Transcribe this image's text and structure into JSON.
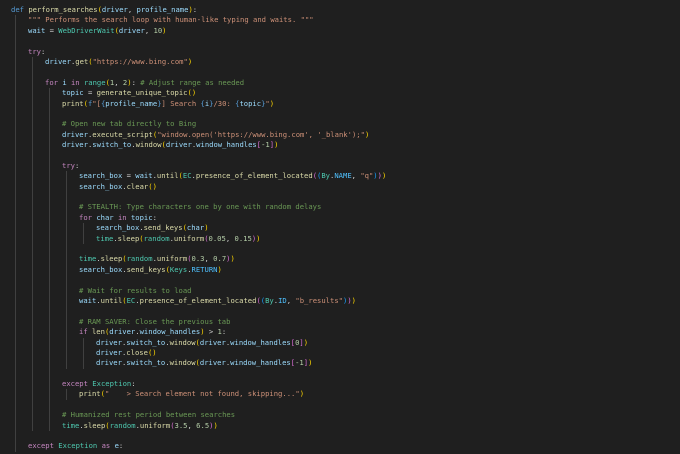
{
  "editor": {
    "lines": [
      {
        "indent": 0,
        "tokens": [
          [
            "k",
            "def"
          ],
          [
            "o",
            " "
          ],
          [
            "f",
            "perform_searches"
          ],
          [
            "b1",
            "("
          ],
          [
            "v",
            "driver"
          ],
          [
            "o",
            ", "
          ],
          [
            "v",
            "profile_name"
          ],
          [
            "b1",
            ")"
          ],
          [
            "o",
            ":"
          ]
        ]
      },
      {
        "indent": 1,
        "tokens": [
          [
            "s",
            "\"\"\" Performs the search loop with human-like typing and waits. \"\"\""
          ]
        ]
      },
      {
        "indent": 1,
        "tokens": [
          [
            "v",
            "wait"
          ],
          [
            "o",
            " = "
          ],
          [
            "cl",
            "WebDriverWait"
          ],
          [
            "b1",
            "("
          ],
          [
            "v",
            "driver"
          ],
          [
            "o",
            ", "
          ],
          [
            "n",
            "10"
          ],
          [
            "b1",
            ")"
          ]
        ]
      },
      {
        "indent": 0,
        "tokens": []
      },
      {
        "indent": 1,
        "tokens": [
          [
            "c",
            "try"
          ],
          [
            "o",
            ":"
          ]
        ]
      },
      {
        "indent": 2,
        "tokens": [
          [
            "v",
            "driver"
          ],
          [
            "o",
            "."
          ],
          [
            "f",
            "get"
          ],
          [
            "b1",
            "("
          ],
          [
            "s",
            "\"https://www.bing.com\""
          ],
          [
            "b1",
            ")"
          ]
        ]
      },
      {
        "indent": 0,
        "tokens": []
      },
      {
        "indent": 2,
        "tokens": [
          [
            "c",
            "for"
          ],
          [
            "o",
            " "
          ],
          [
            "v",
            "i"
          ],
          [
            "o",
            " "
          ],
          [
            "c",
            "in"
          ],
          [
            "o",
            " "
          ],
          [
            "cl",
            "range"
          ],
          [
            "b1",
            "("
          ],
          [
            "n",
            "1"
          ],
          [
            "o",
            ", "
          ],
          [
            "n",
            "2"
          ],
          [
            "b1",
            ")"
          ],
          [
            "o",
            ": "
          ],
          [
            "cm",
            "# Adjust range as needed"
          ]
        ]
      },
      {
        "indent": 3,
        "tokens": [
          [
            "v",
            "topic"
          ],
          [
            "o",
            " = "
          ],
          [
            "f",
            "generate_unique_topic"
          ],
          [
            "b1",
            "()"
          ]
        ]
      },
      {
        "indent": 3,
        "tokens": [
          [
            "f",
            "print"
          ],
          [
            "b1",
            "("
          ],
          [
            "k",
            "f"
          ],
          [
            "s",
            "\"["
          ],
          [
            "k",
            "{"
          ],
          [
            "v",
            "profile_name"
          ],
          [
            "k",
            "}"
          ],
          [
            "s",
            "] Search "
          ],
          [
            "k",
            "{"
          ],
          [
            "v",
            "i"
          ],
          [
            "k",
            "}"
          ],
          [
            "s",
            "/30: "
          ],
          [
            "k",
            "{"
          ],
          [
            "v",
            "topic"
          ],
          [
            "k",
            "}"
          ],
          [
            "s",
            "\""
          ],
          [
            "b1",
            ")"
          ]
        ]
      },
      {
        "indent": 0,
        "tokens": []
      },
      {
        "indent": 3,
        "tokens": [
          [
            "cm",
            "# Open new tab directly to Bing"
          ]
        ]
      },
      {
        "indent": 3,
        "tokens": [
          [
            "v",
            "driver"
          ],
          [
            "o",
            "."
          ],
          [
            "f",
            "execute_script"
          ],
          [
            "b1",
            "("
          ],
          [
            "s",
            "\"window.open('https://www.bing.com', '_blank');\""
          ],
          [
            "b1",
            ")"
          ]
        ]
      },
      {
        "indent": 3,
        "tokens": [
          [
            "v",
            "driver"
          ],
          [
            "o",
            "."
          ],
          [
            "v",
            "switch_to"
          ],
          [
            "o",
            "."
          ],
          [
            "f",
            "window"
          ],
          [
            "b1",
            "("
          ],
          [
            "v",
            "driver"
          ],
          [
            "o",
            "."
          ],
          [
            "v",
            "window_handles"
          ],
          [
            "b2",
            "["
          ],
          [
            "n",
            "-1"
          ],
          [
            "b2",
            "]"
          ],
          [
            "b1",
            ")"
          ]
        ]
      },
      {
        "indent": 0,
        "tokens": []
      },
      {
        "indent": 3,
        "tokens": [
          [
            "c",
            "try"
          ],
          [
            "o",
            ":"
          ]
        ]
      },
      {
        "indent": 4,
        "tokens": [
          [
            "v",
            "search_box"
          ],
          [
            "o",
            " = "
          ],
          [
            "v",
            "wait"
          ],
          [
            "o",
            "."
          ],
          [
            "f",
            "until"
          ],
          [
            "b1",
            "("
          ],
          [
            "cl",
            "EC"
          ],
          [
            "o",
            "."
          ],
          [
            "f",
            "presence_of_element_located"
          ],
          [
            "b2",
            "("
          ],
          [
            "b3",
            "("
          ],
          [
            "cl",
            "By"
          ],
          [
            "o",
            "."
          ],
          [
            "cst",
            "NAME"
          ],
          [
            "o",
            ", "
          ],
          [
            "s",
            "\"q\""
          ],
          [
            "b3",
            ")"
          ],
          [
            "b2",
            ")"
          ],
          [
            "b1",
            ")"
          ]
        ]
      },
      {
        "indent": 4,
        "tokens": [
          [
            "v",
            "search_box"
          ],
          [
            "o",
            "."
          ],
          [
            "f",
            "clear"
          ],
          [
            "b1",
            "()"
          ]
        ]
      },
      {
        "indent": 0,
        "tokens": []
      },
      {
        "indent": 4,
        "tokens": [
          [
            "cm",
            "# STEALTH: Type characters one by one with random delays"
          ]
        ]
      },
      {
        "indent": 4,
        "tokens": [
          [
            "c",
            "for"
          ],
          [
            "o",
            " "
          ],
          [
            "v",
            "char"
          ],
          [
            "o",
            " "
          ],
          [
            "c",
            "in"
          ],
          [
            "o",
            " "
          ],
          [
            "v",
            "topic"
          ],
          [
            "o",
            ":"
          ]
        ]
      },
      {
        "indent": 5,
        "tokens": [
          [
            "v",
            "search_box"
          ],
          [
            "o",
            "."
          ],
          [
            "f",
            "send_keys"
          ],
          [
            "b1",
            "("
          ],
          [
            "v",
            "char"
          ],
          [
            "b1",
            ")"
          ]
        ]
      },
      {
        "indent": 5,
        "tokens": [
          [
            "cl",
            "time"
          ],
          [
            "o",
            "."
          ],
          [
            "f",
            "sleep"
          ],
          [
            "b1",
            "("
          ],
          [
            "cl",
            "random"
          ],
          [
            "o",
            "."
          ],
          [
            "f",
            "uniform"
          ],
          [
            "b2",
            "("
          ],
          [
            "n",
            "0.05"
          ],
          [
            "o",
            ", "
          ],
          [
            "n",
            "0.15"
          ],
          [
            "b2",
            ")"
          ],
          [
            "b1",
            ")"
          ]
        ]
      },
      {
        "indent": 0,
        "tokens": []
      },
      {
        "indent": 4,
        "tokens": [
          [
            "cl",
            "time"
          ],
          [
            "o",
            "."
          ],
          [
            "f",
            "sleep"
          ],
          [
            "b1",
            "("
          ],
          [
            "cl",
            "random"
          ],
          [
            "o",
            "."
          ],
          [
            "f",
            "uniform"
          ],
          [
            "b2",
            "("
          ],
          [
            "n",
            "0.3"
          ],
          [
            "o",
            ", "
          ],
          [
            "n",
            "0.7"
          ],
          [
            "b2",
            ")"
          ],
          [
            "b1",
            ")"
          ]
        ]
      },
      {
        "indent": 4,
        "tokens": [
          [
            "v",
            "search_box"
          ],
          [
            "o",
            "."
          ],
          [
            "f",
            "send_keys"
          ],
          [
            "b1",
            "("
          ],
          [
            "cl",
            "Keys"
          ],
          [
            "o",
            "."
          ],
          [
            "cst",
            "RETURN"
          ],
          [
            "b1",
            ")"
          ]
        ]
      },
      {
        "indent": 0,
        "tokens": []
      },
      {
        "indent": 4,
        "tokens": [
          [
            "cm",
            "# Wait for results to load"
          ]
        ]
      },
      {
        "indent": 4,
        "tokens": [
          [
            "v",
            "wait"
          ],
          [
            "o",
            "."
          ],
          [
            "f",
            "until"
          ],
          [
            "b1",
            "("
          ],
          [
            "cl",
            "EC"
          ],
          [
            "o",
            "."
          ],
          [
            "f",
            "presence_of_element_located"
          ],
          [
            "b2",
            "("
          ],
          [
            "b3",
            "("
          ],
          [
            "cl",
            "By"
          ],
          [
            "o",
            "."
          ],
          [
            "cst",
            "ID"
          ],
          [
            "o",
            ", "
          ],
          [
            "s",
            "\"b_results\""
          ],
          [
            "b3",
            ")"
          ],
          [
            "b2",
            ")"
          ],
          [
            "b1",
            ")"
          ]
        ]
      },
      {
        "indent": 0,
        "tokens": []
      },
      {
        "indent": 4,
        "tokens": [
          [
            "cm",
            "# RAM SAVER: Close the previous tab"
          ]
        ]
      },
      {
        "indent": 4,
        "tokens": [
          [
            "c",
            "if"
          ],
          [
            "o",
            " "
          ],
          [
            "f",
            "len"
          ],
          [
            "b1",
            "("
          ],
          [
            "v",
            "driver"
          ],
          [
            "o",
            "."
          ],
          [
            "v",
            "window_handles"
          ],
          [
            "b1",
            ")"
          ],
          [
            "o",
            " > "
          ],
          [
            "n",
            "1"
          ],
          [
            "o",
            ":"
          ]
        ]
      },
      {
        "indent": 5,
        "tokens": [
          [
            "v",
            "driver"
          ],
          [
            "o",
            "."
          ],
          [
            "v",
            "switch_to"
          ],
          [
            "o",
            "."
          ],
          [
            "f",
            "window"
          ],
          [
            "b1",
            "("
          ],
          [
            "v",
            "driver"
          ],
          [
            "o",
            "."
          ],
          [
            "v",
            "window_handles"
          ],
          [
            "b2",
            "["
          ],
          [
            "n",
            "0"
          ],
          [
            "b2",
            "]"
          ],
          [
            "b1",
            ")"
          ]
        ]
      },
      {
        "indent": 5,
        "tokens": [
          [
            "v",
            "driver"
          ],
          [
            "o",
            "."
          ],
          [
            "f",
            "close"
          ],
          [
            "b1",
            "()"
          ]
        ]
      },
      {
        "indent": 5,
        "tokens": [
          [
            "v",
            "driver"
          ],
          [
            "o",
            "."
          ],
          [
            "v",
            "switch_to"
          ],
          [
            "o",
            "."
          ],
          [
            "f",
            "window"
          ],
          [
            "b1",
            "("
          ],
          [
            "v",
            "driver"
          ],
          [
            "o",
            "."
          ],
          [
            "v",
            "window_handles"
          ],
          [
            "b2",
            "["
          ],
          [
            "n",
            "-1"
          ],
          [
            "b2",
            "]"
          ],
          [
            "b1",
            ")"
          ]
        ]
      },
      {
        "indent": 0,
        "tokens": []
      },
      {
        "indent": 3,
        "tokens": [
          [
            "c",
            "except"
          ],
          [
            "o",
            " "
          ],
          [
            "cl",
            "Exception"
          ],
          [
            "o",
            ":"
          ]
        ]
      },
      {
        "indent": 4,
        "tokens": [
          [
            "f",
            "print"
          ],
          [
            "b1",
            "("
          ],
          [
            "s",
            "\"    > Search element not found, skipping...\""
          ],
          [
            "b1",
            ")"
          ]
        ]
      },
      {
        "indent": 0,
        "tokens": []
      },
      {
        "indent": 3,
        "tokens": [
          [
            "cm",
            "# Humanized rest period between searches"
          ]
        ]
      },
      {
        "indent": 3,
        "tokens": [
          [
            "cl",
            "time"
          ],
          [
            "o",
            "."
          ],
          [
            "f",
            "sleep"
          ],
          [
            "b1",
            "("
          ],
          [
            "cl",
            "random"
          ],
          [
            "o",
            "."
          ],
          [
            "f",
            "uniform"
          ],
          [
            "b2",
            "("
          ],
          [
            "n",
            "3.5"
          ],
          [
            "o",
            ", "
          ],
          [
            "n",
            "6.5"
          ],
          [
            "b2",
            ")"
          ],
          [
            "b1",
            ")"
          ]
        ]
      },
      {
        "indent": 0,
        "tokens": []
      },
      {
        "indent": 1,
        "tokens": [
          [
            "c",
            "except"
          ],
          [
            "o",
            " "
          ],
          [
            "cl",
            "Exception"
          ],
          [
            "o",
            " "
          ],
          [
            "c",
            "as"
          ],
          [
            "o",
            " "
          ],
          [
            "v",
            "e"
          ],
          [
            "o",
            ":"
          ]
        ]
      }
    ]
  },
  "colors": {
    "background": "#1f1f1f",
    "keyword": "#569cd6",
    "control": "#c586c0",
    "function": "#dcdcaa",
    "variable": "#9cdcfe",
    "string": "#ce9178",
    "number": "#b5cea8",
    "comment": "#6a9955",
    "class": "#4ec9b0"
  }
}
